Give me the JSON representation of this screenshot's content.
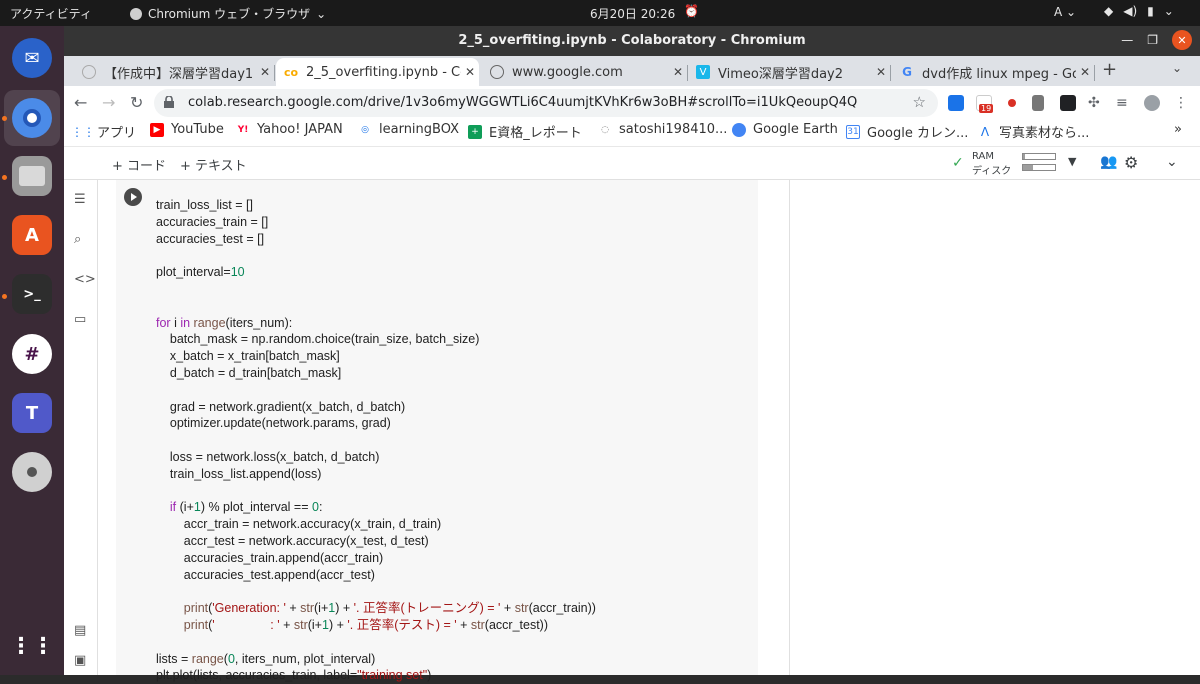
{
  "system": {
    "activities": "アクティビティ",
    "app_menu": "Chromium ウェブ・ブラウザ",
    "clock": "6月20日 20:26",
    "input_method": "A"
  },
  "window": {
    "title": "2_5_overfiting.ipynb - Colaboratory - Chromium"
  },
  "tabs": [
    {
      "label": "【作成中】深層学習day1"
    },
    {
      "label": "2_5_overfiting.ipynb - Co"
    },
    {
      "label": "www.google.com"
    },
    {
      "label": "Vimeo深層学習day2"
    },
    {
      "label": "dvd作成 linux mpeg - Goo"
    }
  ],
  "omnibox": {
    "url": "colab.research.google.com/drive/1v3o6myWGGWTLi6C4uumjtKVhKr6w3oBH#scrollTo=i1UkQeoupQ4Q"
  },
  "extensions": {
    "gmail_badge": "19"
  },
  "bookmarks": [
    {
      "label": "アプリ"
    },
    {
      "label": "YouTube"
    },
    {
      "label": "Yahoo! JAPAN"
    },
    {
      "label": "learningBOX"
    },
    {
      "label": "E資格_レポート"
    },
    {
      "label": "satoshi198410..."
    },
    {
      "label": "Google Earth"
    },
    {
      "label": "Google カレン..."
    },
    {
      "label": "写真素材なら..."
    }
  ],
  "colab": {
    "add_code": "+ コード",
    "add_text": "+ テキスト",
    "ram_label": "RAM",
    "disk_label": "ディスク",
    "ram_usage": 0.05,
    "disk_usage": 0.3
  },
  "code_lines": [
    "train_loss_list = []",
    "accuracies_train = []",
    "accuracies_test = []",
    "",
    "plot_interval=10",
    "",
    "",
    "for i in range(iters_num):",
    "    batch_mask = np.random.choice(train_size, batch_size)",
    "    x_batch = x_train[batch_mask]",
    "    d_batch = d_train[batch_mask]",
    "",
    "    grad = network.gradient(x_batch, d_batch)",
    "    optimizer.update(network.params, grad)",
    "",
    "    loss = network.loss(x_batch, d_batch)",
    "    train_loss_list.append(loss)",
    "",
    "    if (i+1) % plot_interval == 0:",
    "        accr_train = network.accuracy(x_train, d_train)",
    "        accr_test = network.accuracy(x_test, d_test)",
    "        accuracies_train.append(accr_train)",
    "        accuracies_test.append(accr_test)",
    "",
    "        print('Generation: ' + str(i+1) + '. 正答率(トレーニング) = ' + str(accr_train))",
    "        print('                : ' + str(i+1) + '. 正答率(テスト) = ' + str(accr_test))",
    "",
    "lists = range(0, iters_num, plot_interval)",
    "plt.plot(lists, accuracies_train, label=\"training set\")"
  ]
}
